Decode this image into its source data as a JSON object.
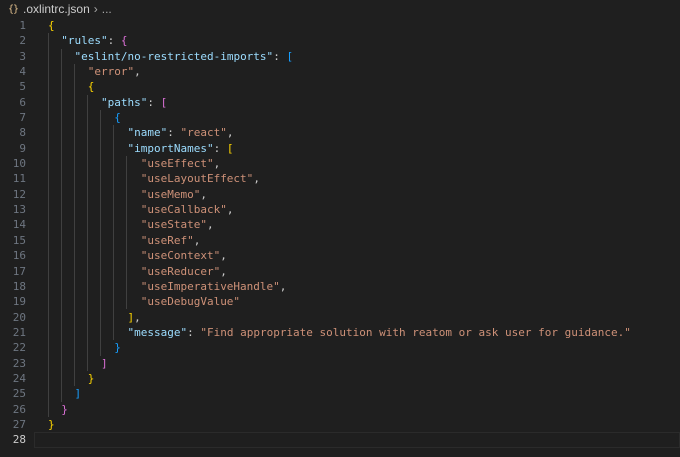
{
  "breadcrumb": {
    "icon": "json-braces-icon",
    "icon_glyph": "{}",
    "file": ".oxlintrc.json",
    "separator": "›",
    "more": "..."
  },
  "line_numbers": [
    "1",
    "2",
    "3",
    "4",
    "5",
    "6",
    "7",
    "8",
    "9",
    "10",
    "11",
    "12",
    "13",
    "14",
    "15",
    "16",
    "17",
    "18",
    "19",
    "20",
    "21",
    "22",
    "23",
    "24",
    "25",
    "26",
    "27",
    "28"
  ],
  "code": {
    "l1_brace": "{",
    "rules_key": "\"rules\"",
    "l2_brace": "{",
    "rule_key": "\"eslint/no-restricted-imports\"",
    "l3_bracket": "[",
    "error_str": "\"error\"",
    "l5_brace": "{",
    "paths_key": "\"paths\"",
    "l6_bracket": "[",
    "l7_brace": "{",
    "name_key": "\"name\"",
    "name_val": "\"react\"",
    "importNames_key": "\"importNames\"",
    "l9_bracket": "[",
    "import_names": [
      "\"useEffect\"",
      "\"useLayoutEffect\"",
      "\"useMemo\"",
      "\"useCallback\"",
      "\"useState\"",
      "\"useRef\"",
      "\"useContext\"",
      "\"useReducer\"",
      "\"useImperativeHandle\"",
      "\"useDebugValue\""
    ],
    "l20_bracket": "]",
    "message_key": "\"message\"",
    "message_val": "\"Find appropriate solution with reatom or ask user for guidance.\"",
    "l22_brace": "}",
    "l23_bracket": "]",
    "l24_brace": "}",
    "l25_bracket": "]",
    "l26_brace": "}",
    "l27_brace": "}"
  },
  "colors": {
    "background": "#1f1f1f",
    "key": "#9cdcfe",
    "string": "#ce9178",
    "bracket_level1": "#ffd700",
    "bracket_level2": "#da70d6",
    "bracket_level3": "#179fff"
  }
}
